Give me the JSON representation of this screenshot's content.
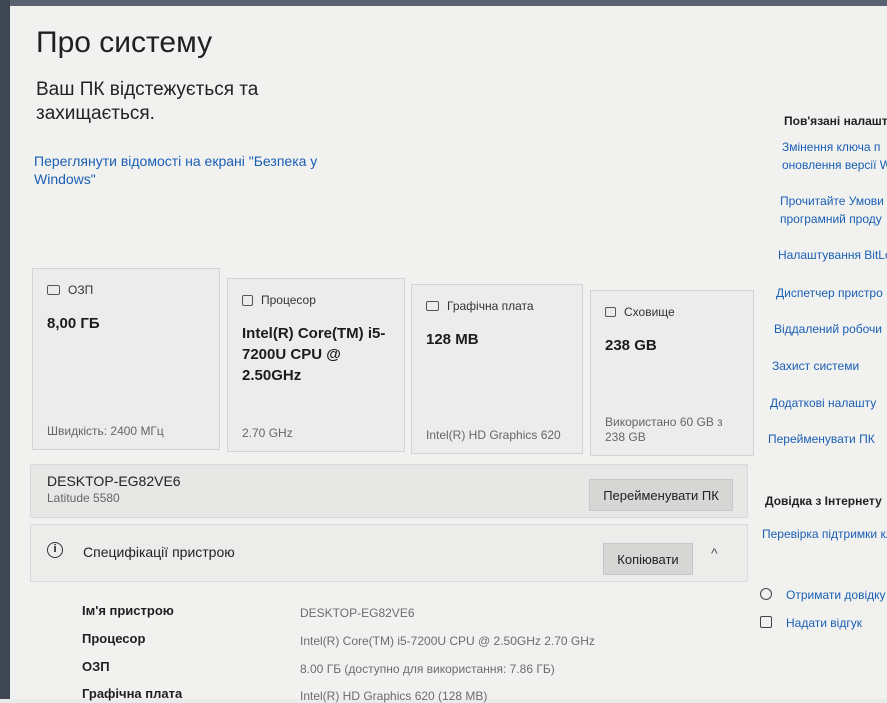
{
  "page": {
    "title": "Про систему",
    "status": "Ваш ПК відстежується та захищається.",
    "security_link": "Переглянути відомості на екрані \"Безпека у Windows\""
  },
  "cards": [
    {
      "label": "ОЗП",
      "value": "8,00 ГБ",
      "footer": "Швидкість: 2400 МГц",
      "icon": "ram-icon"
    },
    {
      "label": "Процесор",
      "value": "Intel(R) Core(TM) i5-7200U CPU @ 2.50GHz",
      "footer": "2.70 GHz",
      "icon": "cpu-icon"
    },
    {
      "label": "Графічна плата",
      "value": "128 MB",
      "footer": "Intel(R) HD Graphics 620",
      "icon": "gpu-icon"
    },
    {
      "label": "Сховище",
      "value": "238 GB",
      "footer": "Використано 60 GB з 238 GB",
      "icon": "storage-icon"
    }
  ],
  "device": {
    "name": "DESKTOP-EG82VE6",
    "model": "Latitude 5580",
    "rename_button": "Перейменувати ПК"
  },
  "specs": {
    "header": "Специфікації пристрою",
    "copy_button": "Копіювати",
    "rows": [
      {
        "key": "Ім'я пристрою",
        "value": "DESKTOP-EG82VE6"
      },
      {
        "key": "Процесор",
        "value": "Intel(R) Core(TM) i5-7200U CPU @ 2.50GHz   2.70 GHz"
      },
      {
        "key": "ОЗП",
        "value": "8.00 ГБ (доступно для використання: 7.86 ГБ)"
      },
      {
        "key": "Графічна плата",
        "value": "Intel(R) HD Graphics 620 (128 MB)"
      }
    ]
  },
  "related": {
    "title": "Пов'язані налашту",
    "links": [
      "Змінення ключа п",
      "оновлення версії W",
      "Прочитайте Умови",
      "програмний проду",
      "Налаштування BitLo",
      "Диспетчер пристро",
      "Віддалений робочи",
      "Захист системи",
      "Додаткові налашту",
      "Перейменувати ПК"
    ]
  },
  "help": {
    "title": "Довідка з Інтернету",
    "link": "Перевірка підтримки кл",
    "get_help": "Отримати довідку",
    "feedback": "Надати відгук"
  }
}
